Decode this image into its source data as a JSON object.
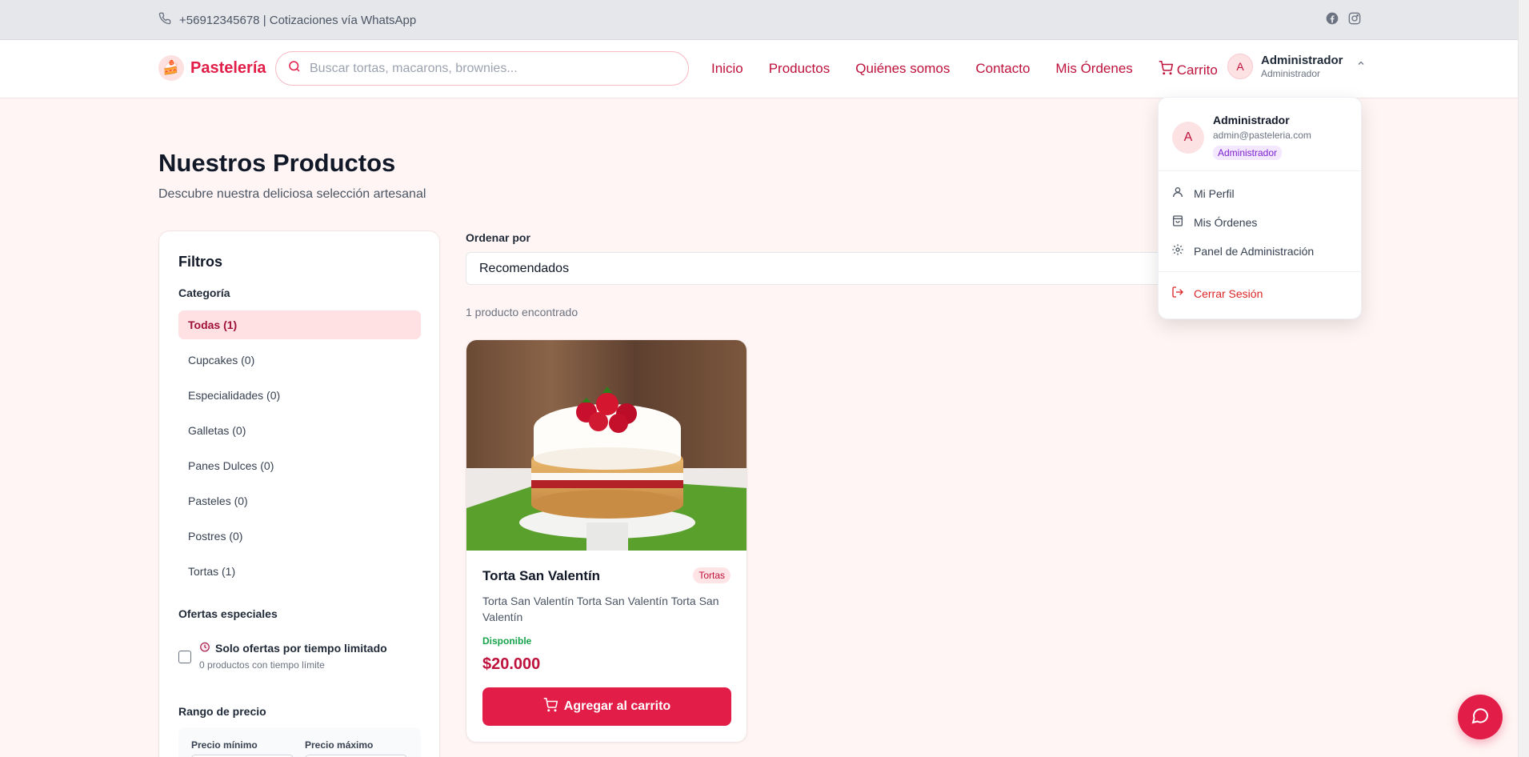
{
  "topbar": {
    "phone_text": "+56912345678 | Cotizaciones vía WhatsApp"
  },
  "header": {
    "logo_text": "Pastelería",
    "search_placeholder": "Buscar tortas, macarons, brownies...",
    "nav": [
      "Inicio",
      "Productos",
      "Quiénes somos",
      "Contacto",
      "Mis Órdenes",
      "Carrito"
    ],
    "user": {
      "initial": "A",
      "name": "Administrador",
      "role": "Administrador"
    }
  },
  "page": {
    "title": "Nuestros Productos",
    "subtitle": "Descubre nuestra deliciosa selección artesanal"
  },
  "filters": {
    "title": "Filtros",
    "category_label": "Categoría",
    "categories": [
      "Todas (1)",
      "Cupcakes (0)",
      "Especialidades (0)",
      "Galletas (0)",
      "Panes Dulces (0)",
      "Pasteles (0)",
      "Postres (0)",
      "Tortas (1)"
    ],
    "offers_label": "Ofertas especiales",
    "offer_title": "Solo ofertas por tiempo limitado",
    "offer_sub": "0 productos con tiempo límite",
    "price_label": "Rango de precio",
    "price_min_label": "Precio mínimo",
    "price_max_label": "Precio máximo"
  },
  "sort": {
    "label": "Ordenar por",
    "value": "Recomendados"
  },
  "results_count": "1 producto encontrado",
  "product": {
    "name": "Torta San Valentín",
    "tag": "Tortas",
    "description": "Torta San Valentín Torta San Valentín Torta San Valentín",
    "stock": "Disponible",
    "price": "$20.000",
    "button": "Agregar al carrito"
  },
  "dropdown": {
    "initial": "A",
    "name": "Administrador",
    "email": "admin@pasteleria.com",
    "role": "Administrador",
    "items": [
      "Mi Perfil",
      "Mis Órdenes",
      "Panel de Administración"
    ],
    "logout": "Cerrar Sesión"
  },
  "colors": {
    "accent": "#e11d48",
    "accent_dark": "#be123c",
    "background": "#fff5f4",
    "success": "#16a34a"
  }
}
